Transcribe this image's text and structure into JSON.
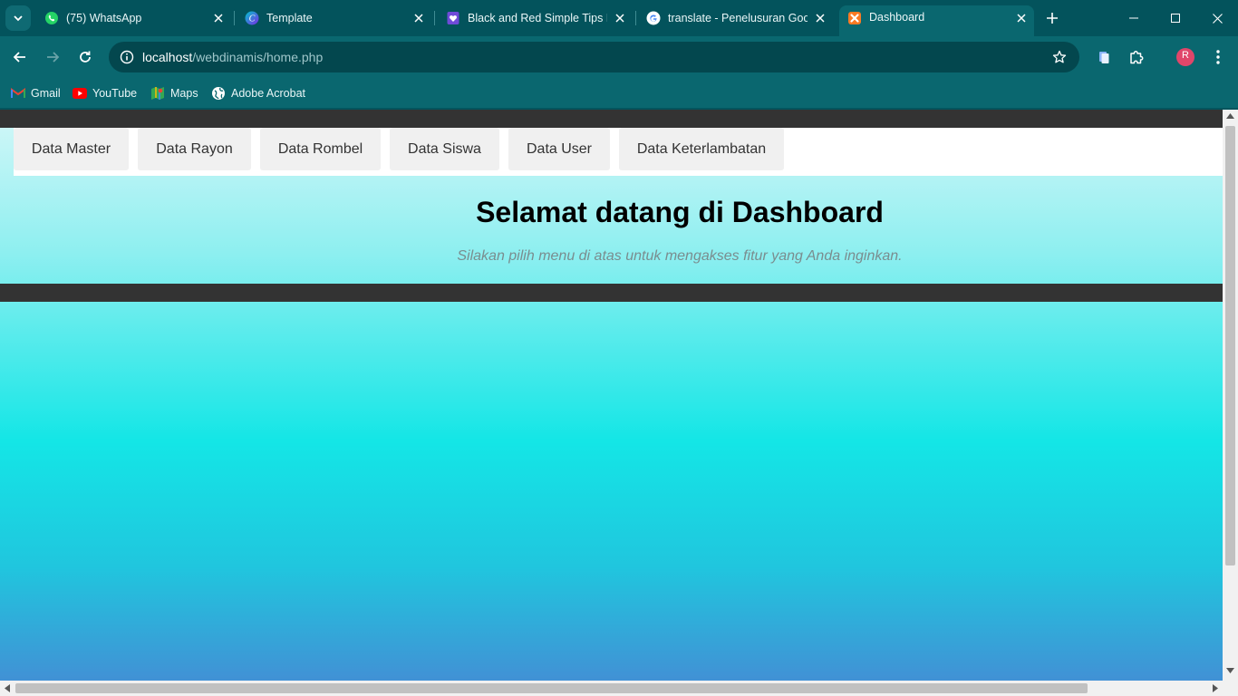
{
  "browser": {
    "tabs": [
      {
        "title": "(75) WhatsApp",
        "icon": "whatsapp-icon",
        "active": false
      },
      {
        "title": "Template",
        "icon": "canva-icon",
        "active": false
      },
      {
        "title": "Black and Red Simple Tips H",
        "icon": "heart-doc-icon",
        "active": false
      },
      {
        "title": "translate - Penelusuran Goo",
        "icon": "google-icon",
        "active": false
      },
      {
        "title": "Dashboard",
        "icon": "xampp-icon",
        "active": true
      }
    ],
    "address": {
      "host": "localhost",
      "path": "/webdinamis/home.php"
    },
    "bookmarks": [
      {
        "label": "Gmail",
        "icon": "gmail-icon"
      },
      {
        "label": "YouTube",
        "icon": "youtube-icon"
      },
      {
        "label": "Maps",
        "icon": "maps-icon"
      },
      {
        "label": "Adobe Acrobat",
        "icon": "globe-icon"
      }
    ],
    "profile_initial": "R",
    "colors": {
      "frame": "#03535c",
      "toolbar": "#0a676f",
      "accent_profile": "#e0466a"
    }
  },
  "page": {
    "nav": [
      "Data Master",
      "Data Rayon",
      "Data Rombel",
      "Data Siswa",
      "Data User",
      "Data Keterlambatan"
    ],
    "heading": "Selamat datang di Dashboard",
    "subtitle": "Silakan pilih menu di atas untuk mengakses fitur yang Anda inginkan.",
    "colors": {
      "header_bar": "#333333",
      "gradient_top": "#d4f7f8",
      "gradient_mid": "#14e6e6",
      "gradient_bottom": "#4191d5"
    }
  }
}
